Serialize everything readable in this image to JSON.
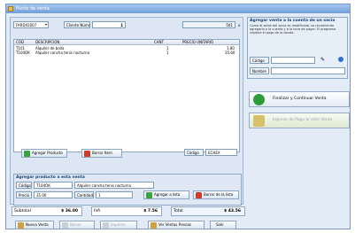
{
  "window": {
    "title": "Punto de venta"
  },
  "header": {
    "terminal_select": "FARD41007",
    "client_label": "Cliente Número",
    "client_value": "1",
    "extra_value": "501",
    "extra_suffix": "x"
  },
  "grid": {
    "columns": [
      "COD",
      "DESCRIPCION",
      "CANT",
      "PRECIO UNITARIO"
    ],
    "rows": [
      {
        "code": "T101",
        "description": "Alquiler de bolla",
        "qty": "1",
        "price": "1.80"
      },
      {
        "code": "T104OK",
        "description": "Alquiler cancha tenis nocturna",
        "qty": "1",
        "price": "35.60"
      }
    ]
  },
  "actions": {
    "add_product": "Agregar Producto",
    "delete_item": "Borrar Item",
    "code_label": "Código",
    "code_value": "ECHEX"
  },
  "add_section": {
    "title": "Agregar producto a esta venta",
    "code_label": "Código",
    "code_value": "T104OK",
    "desc_value": "Alquiler cancha tenis nocturna",
    "price_label": "Precio",
    "price_value": "35.00",
    "qty_label": "Cantidad",
    "qty_value": "1",
    "add_button": "Agregar a lista",
    "remove_button": "Borrar de la lista"
  },
  "totals": {
    "subtotal_label": "Subtotal",
    "subtotal_value": "$ 36.00",
    "iva_label": "IVA",
    "iva_value": "$ 7.56",
    "total_label": "Total",
    "total_value": "$ 43.56"
  },
  "bottom": {
    "new_sale": "Nueva Venta",
    "btn2": "Borrar",
    "btn3": "Imprimir",
    "view_pending": "Ver Ventas Previas",
    "exit": "Salir"
  },
  "right": {
    "title": "Agregar venta a la cuenta de un socio",
    "text": "Como el saldo del socio es modificado, se recomienda agregarlo a la cuenta y a la hora de pagar. El programa registra el pago de la deuda.",
    "code_label": "Código",
    "name_label": "Nombre",
    "finalize": "Finalizar y Continuar Venta",
    "register_payment": "Ingreso de Pago a/ este Venta"
  }
}
